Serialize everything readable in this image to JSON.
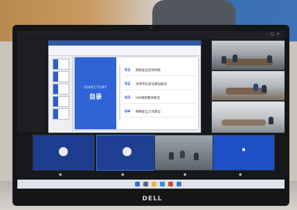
{
  "brand": "DELL",
  "meeting": {
    "window_title": "",
    "presentation_title": "",
    "ribbon_tabs": [
      "",
      "",
      "",
      "",
      "",
      ""
    ]
  },
  "slide": {
    "heading_en": "DIRECTORY",
    "heading_cn": "目录",
    "agenda": [
      {
        "num": "01",
        "text": "网络安全形势判断"
      },
      {
        "num": "02",
        "text": "深圳市信息化建设概况"
      },
      {
        "num": "03",
        "text": "HW演练整体情况"
      },
      {
        "num": "04",
        "text": "网络安全工作建议"
      }
    ]
  },
  "tiles": [
    {
      "name": ""
    },
    {
      "name": ""
    },
    {
      "name": ""
    },
    {
      "name": ""
    }
  ],
  "colors": {
    "slide_blue": "#2f63d6",
    "tile_blue": "#1e4fc4",
    "screen_bg": "#15171a"
  },
  "icons": [
    "webcam-icon",
    "avatar-icon",
    "chevron-right-icon",
    "window-controls-icon"
  ]
}
